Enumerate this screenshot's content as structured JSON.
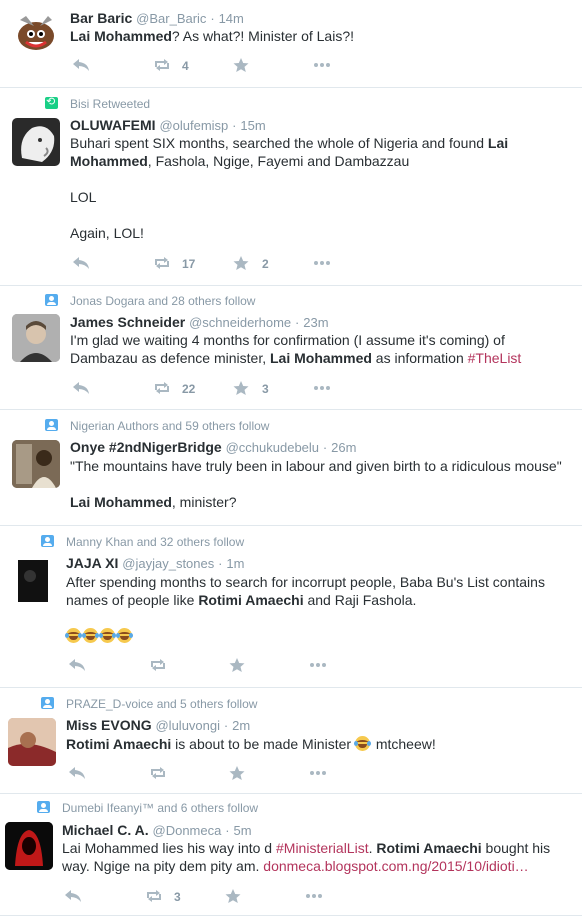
{
  "colors": {
    "accent": "#b3345c",
    "muted": "#8899a6",
    "icon": "#aab8c2",
    "retweet_green": "#19cf86",
    "follow_blue": "#55acee"
  },
  "tweets": [
    {
      "context": "",
      "name": "Bar Baric",
      "handle": "@Bar_Baric",
      "time": "14m",
      "body": [
        [
          "b",
          "Lai Mohammed"
        ],
        [
          "t",
          "? As what?! Minister of Lais?!"
        ]
      ],
      "retweets": "4",
      "likes": ""
    },
    {
      "context": "Bisi Retweeted",
      "name": "OLUWAFEMI",
      "handle": "@olufemisp",
      "time": "15m",
      "body": [
        [
          "t",
          "Buhari spent SIX months, searched the whole of Nigeria and found "
        ],
        [
          "b",
          "Lai Mohammed"
        ],
        [
          "t",
          ", Fashola, Ngige, Fayemi and Dambazzau\n\nLOL\n\nAgain, LOL!"
        ]
      ],
      "retweets": "17",
      "likes": "2"
    },
    {
      "context": "Jonas Dogara and 28 others follow",
      "name": "James Schneider",
      "handle": "@schneiderhome",
      "time": "23m",
      "body": [
        [
          "t",
          "I'm glad we waiting 4 months for confirmation (I assume it's coming) of Dambazau as defence minister, "
        ],
        [
          "b",
          "Lai Mohammed"
        ],
        [
          "t",
          " as information "
        ],
        [
          "h",
          "#TheList"
        ]
      ],
      "retweets": "22",
      "likes": "3"
    },
    {
      "context": "Nigerian Authors and 59 others follow",
      "name": "Onye #2ndNigerBridge",
      "handle": "@cchukudebelu",
      "time": "26m",
      "body": [
        [
          "t",
          "\"The mountains have truly been in labour and given birth to a ridiculous mouse\"\n\n"
        ],
        [
          "b",
          "Lai Mohammed"
        ],
        [
          "t",
          ", minister?"
        ]
      ],
      "retweets": "",
      "likes": ""
    },
    {
      "context": "Manny Khan and 32 others follow",
      "name": "JAJA XI",
      "handle": "@jayjay_stones",
      "time": "1m",
      "body": [
        [
          "t",
          "After spending months to search for incorrupt people, Baba Bu's List contains names of people like "
        ],
        [
          "b",
          "Rotimi Amaechi"
        ],
        [
          "t",
          " and Raji Fashola.\n\n"
        ],
        [
          "e",
          "4"
        ]
      ],
      "retweets": "",
      "likes": ""
    },
    {
      "context": "PRAZE_D-voice and 5 others follow",
      "name": "Miss EVONG",
      "handle": "@luluvongi",
      "time": "2m",
      "body": [
        [
          "b",
          "Rotimi Amaechi"
        ],
        [
          "t",
          " is about to be made Minister "
        ],
        [
          "e",
          "1"
        ],
        [
          "t",
          " mtcheew!"
        ]
      ],
      "retweets": "",
      "likes": ""
    },
    {
      "context": "Dumebi Ifeanyi™ and 6 others follow",
      "name": "Michael C. A.",
      "handle": "@Donmeca",
      "time": "5m",
      "body": [
        [
          "t",
          "Lai Mohammed lies his way into d "
        ],
        [
          "h",
          "#MinisterialList"
        ],
        [
          "t",
          ". "
        ],
        [
          "b",
          "Rotimi Amaechi"
        ],
        [
          "t",
          " bought his way. Ngige na pity dem pity am. "
        ],
        [
          "l",
          "donmeca.blogspot.com.ng/2015/10/idioti…"
        ]
      ],
      "retweets": "3",
      "likes": ""
    }
  ]
}
